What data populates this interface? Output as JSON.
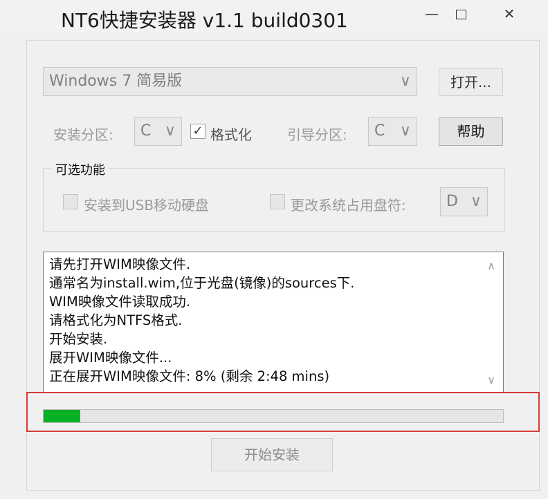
{
  "window": {
    "title": "NT6快捷安装器 v1.1 build0301",
    "minimize_glyph": "—",
    "close_glyph": "✕"
  },
  "edition_select": {
    "value": "Windows 7 简易版",
    "chevron": "∨"
  },
  "open_button": {
    "label": "打开..."
  },
  "install_partition": {
    "label": "安装分区:",
    "value": "C",
    "chevron": "∨"
  },
  "format_checkbox": {
    "checked": true,
    "check_glyph": "✓",
    "label": "格式化"
  },
  "boot_partition": {
    "label": "引导分区:",
    "value": "C",
    "chevron": "∨"
  },
  "help_button": {
    "label": "帮助"
  },
  "optional_features": {
    "title": "可选功能",
    "usb_install": {
      "label": "安装到USB移动硬盘",
      "checked": false
    },
    "change_drive_letter": {
      "label": "更改系统占用盘符:",
      "checked": false
    },
    "drive_letter": {
      "value": "D",
      "chevron": "∨"
    }
  },
  "log": {
    "lines": [
      "请先打开WIM映像文件.",
      "通常名为install.wim,位于光盘(镜像)的sources下.",
      "WIM映像文件读取成功.",
      "请格式化为NTFS格式.",
      "开始安装.",
      "展开WIM映像文件...",
      "正在展开WIM映像文件:  8% (剩余 2:48 mins)"
    ],
    "scroll_up_glyph": "∧",
    "scroll_down_glyph": "∨"
  },
  "progress": {
    "percent": 8,
    "color": "#06b025"
  },
  "start_button": {
    "label": "开始安装"
  },
  "colors": {
    "highlight_border": "#d43b3b",
    "progress_fill": "#06b025"
  }
}
